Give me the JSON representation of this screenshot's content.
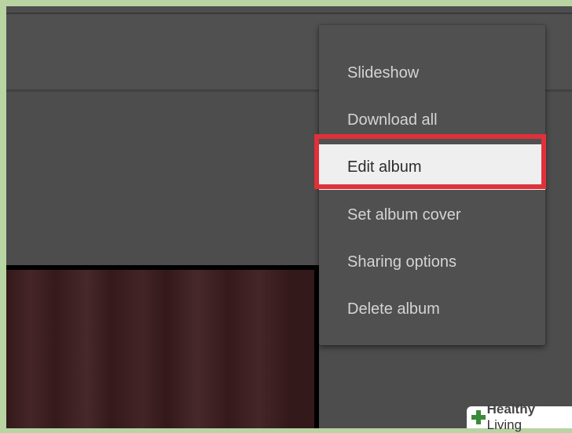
{
  "menu": {
    "items": [
      {
        "label": "Slideshow"
      },
      {
        "label": "Download all"
      },
      {
        "label": "Edit album"
      },
      {
        "label": "Set album cover"
      },
      {
        "label": "Sharing options"
      },
      {
        "label": "Delete album"
      }
    ],
    "highlighted_index": 2
  },
  "watermark": {
    "bold": "Healthy",
    "light": " Living"
  },
  "colors": {
    "background": "#4d4d4d",
    "menu_bg": "#505050",
    "highlight_bg": "#efefef",
    "annotation_border": "#e0303a",
    "frame_border": "#b8d4a2",
    "logo": "#3b8a3b"
  }
}
